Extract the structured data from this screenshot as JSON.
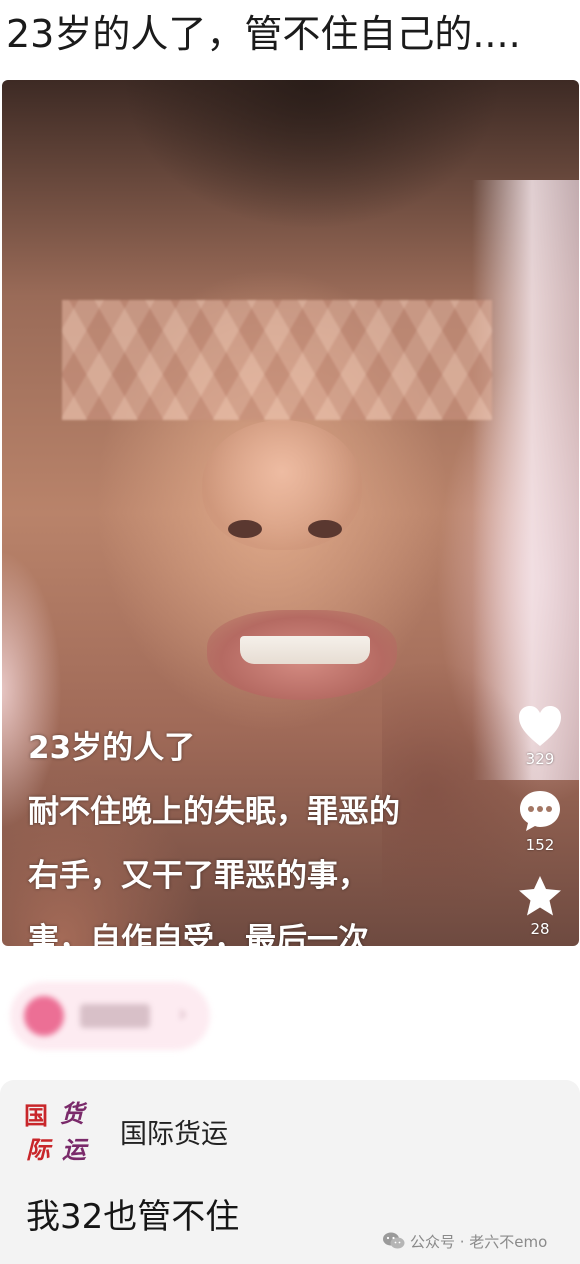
{
  "post": {
    "title": "23岁的人了，管不住自己的...."
  },
  "video": {
    "caption_lines": [
      "23岁的人了",
      "耐不住晚上的失眠，罪恶的",
      "右手，又干了罪恶的事，",
      "害，自作自受，最后一次"
    ],
    "actions": {
      "like": {
        "icon": "heart-icon",
        "count": "329"
      },
      "comment": {
        "icon": "comment-bubble-icon",
        "count": "152"
      },
      "favorite": {
        "icon": "star-icon",
        "count": "28"
      },
      "share": {
        "icon": "share-arrow-icon"
      }
    }
  },
  "comment": {
    "commenter_logo_chars": [
      "国",
      "货",
      "际",
      "运"
    ],
    "commenter_name": "国际货运",
    "text": "我32也管不住"
  },
  "watermark": {
    "icon": "wechat-icon",
    "text": "公众号 · 老六不emo"
  },
  "colors": {
    "logo_red": "#c8262a",
    "logo_purple": "#7a2a6a",
    "comment_bg": "#f3f3f3",
    "chip_pink": "#ec6f95"
  }
}
